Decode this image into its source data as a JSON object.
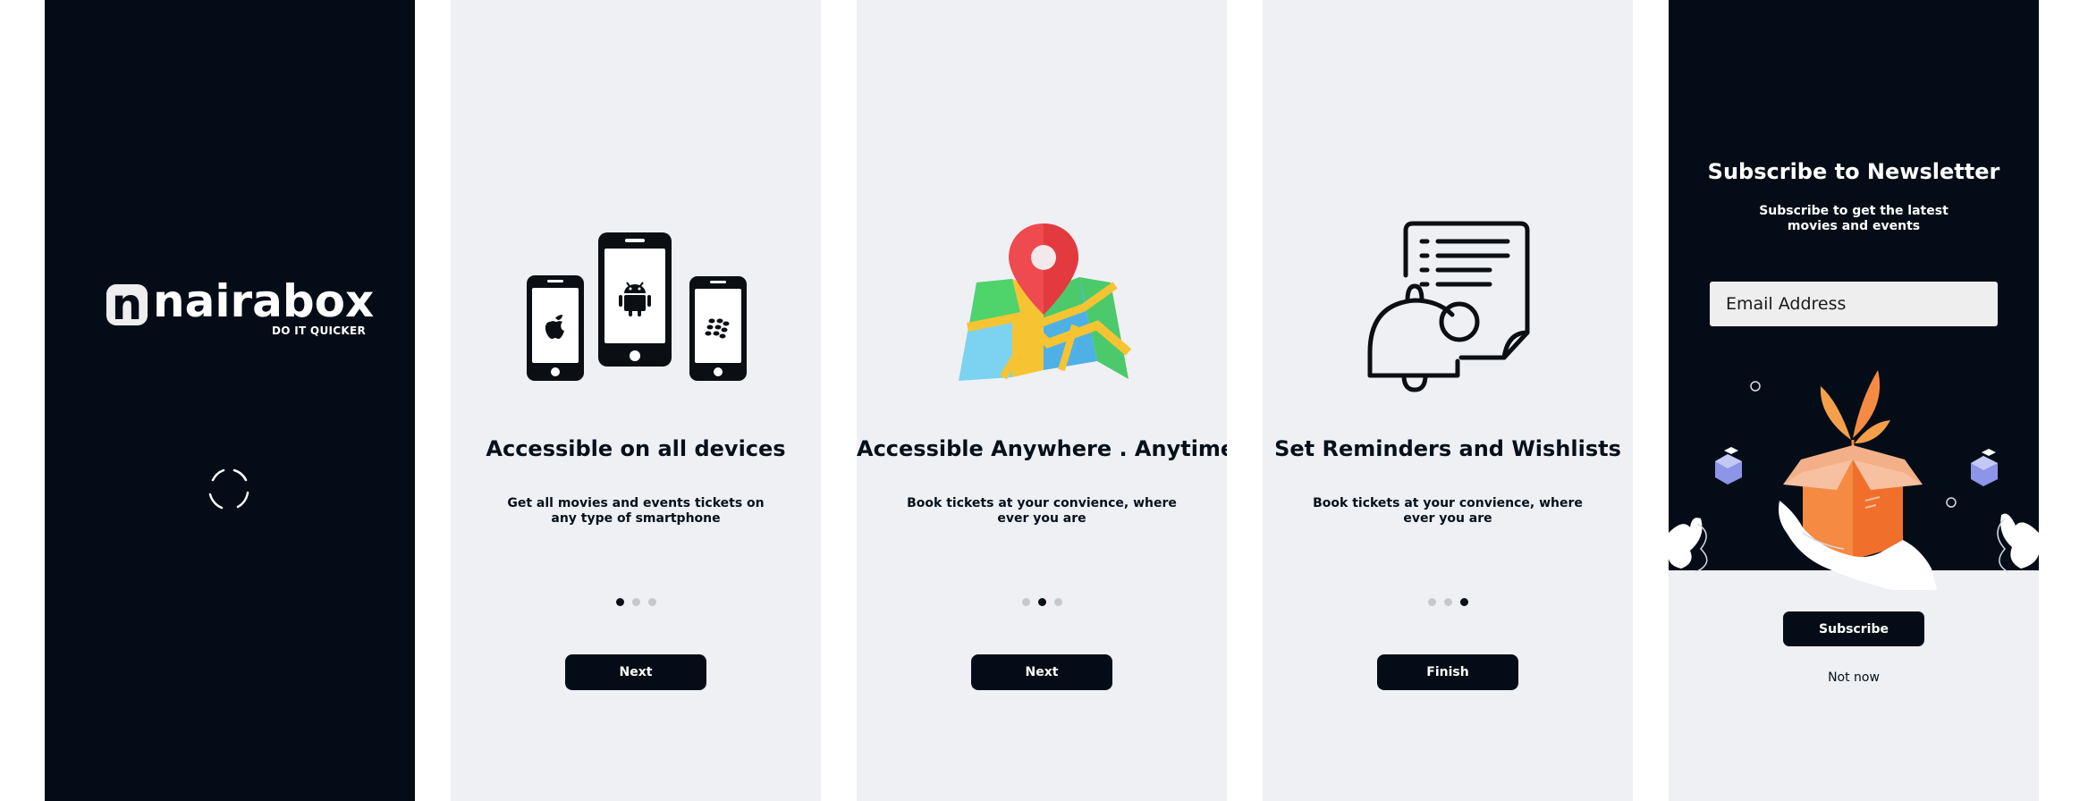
{
  "splash": {
    "logo_mark": "n",
    "logo_text": "nairabox",
    "logo_tagline": "DO IT QUICKER"
  },
  "onboarding": [
    {
      "title": "Accessible on all devices",
      "subtitle": "Get all movies  and events tickets on any type of smartphone",
      "button": "Next",
      "active_dot": 0,
      "illustration": "devices-icon"
    },
    {
      "title": "Accessible Anywhere . Anytime",
      "subtitle": "Book tickets at your convience, where ever you are",
      "button": "Next",
      "active_dot": 1,
      "illustration": "map-pin-icon"
    },
    {
      "title": "Set Reminders and Wishlists",
      "subtitle": "Book tickets at your convience, where ever you are",
      "button": "Finish",
      "active_dot": 2,
      "illustration": "bell-list-icon"
    }
  ],
  "newsletter": {
    "title": "Subscribe to Newsletter",
    "subtitle": "Subscribe to get the latest movies and events",
    "email_placeholder": "Email Address",
    "subscribe_button": "Subscribe",
    "skip_link": "Not now"
  },
  "colors": {
    "dark": "#040d17",
    "light": "#eff0f4",
    "accent_red": "#ef4a4f",
    "accent_orange": "#f58a43"
  }
}
